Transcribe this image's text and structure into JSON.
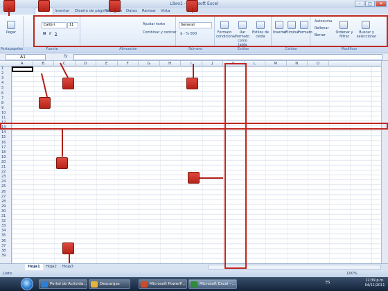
{
  "window": {
    "title": "Libro1 - Microsoft Excel",
    "min": "–",
    "max": "□",
    "close": "✕"
  },
  "tabs": [
    "Inicio",
    "Insertar",
    "Diseño de página",
    "Fórmulas",
    "Datos",
    "Revisar",
    "Vista"
  ],
  "ribbon": {
    "paste": "Pegar",
    "font_name": "Calibri",
    "font_size": "11",
    "wrap": "Ajustar texto",
    "merge": "Combinar y centrar",
    "number_format": "General",
    "number_symbols": "$ - % 000",
    "cond_format": "Formato condicional",
    "table_format": "Dar formato como tabla",
    "cell_styles": "Estilos de celda",
    "insert": "Insertar",
    "delete": "Eliminar",
    "format": "Formato",
    "autosum": "Autosuma",
    "fill": "Rellenar",
    "clear": "Borrar",
    "sort": "Ordenar y filtrar",
    "find": "Buscar y seleccionar",
    "groups": [
      "Portapapeles",
      "Fuente",
      "Alineación",
      "Número",
      "Estilos",
      "Celdas",
      "Modificar"
    ]
  },
  "formula_bar": {
    "name_box": "A1",
    "fx": "fx",
    "content": ""
  },
  "columns": [
    "A",
    "B",
    "C",
    "D",
    "E",
    "F",
    "G",
    "H",
    "I",
    "J",
    "K",
    "L",
    "M",
    "N",
    "O"
  ],
  "rows": [
    "1",
    "2",
    "3",
    "4",
    "5",
    "6",
    "7",
    "8",
    "9",
    "10",
    "11",
    "12",
    "13",
    "14",
    "15",
    "16",
    "17",
    "18",
    "19",
    "20",
    "21",
    "22",
    "23",
    "24",
    "25",
    "26",
    "27",
    "28",
    "29",
    "30",
    "31",
    "32",
    "33",
    "34",
    "35",
    "36",
    "37",
    "38",
    "39"
  ],
  "sheets": [
    "Hoja1",
    "Hoja2",
    "Hoja3"
  ],
  "status": {
    "text": "Listo",
    "zoom": "100%"
  },
  "taskbar": {
    "items": [
      "Portal de Activida...",
      "Descargas",
      "Microsoft PowerP...",
      "Microsoft Excel - ..."
    ],
    "tray": "ES",
    "time": "12:39 p.m.",
    "date": "04/11/2011"
  },
  "colors": {
    "annotation_red": "#c02720",
    "ribbon_blue": "#dbe7f6",
    "accent": "#15428b"
  }
}
